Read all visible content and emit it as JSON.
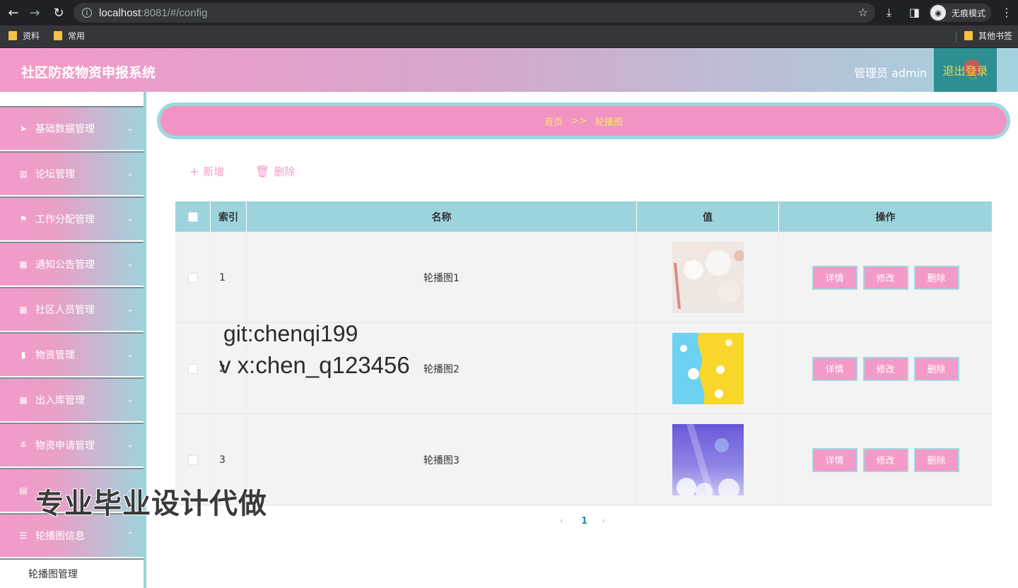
{
  "browser": {
    "url_host": "localhost",
    "url_rest": ":8081/#/config",
    "incognito_label": "无痕模式",
    "bookmarks": [
      "资料",
      "常用"
    ],
    "other_bookmarks": "其他书签"
  },
  "header": {
    "title": "社区防疫物资申报系统",
    "admin_label": "管理员 admin",
    "logout_label": "退出登录"
  },
  "sidebar": {
    "items": [
      {
        "label": "基础数据管理",
        "icon": "send-icon"
      },
      {
        "label": "论坛管理",
        "icon": "chart-icon"
      },
      {
        "label": "工作分配管理",
        "icon": "flag-icon"
      },
      {
        "label": "通知公告管理",
        "icon": "grid-icon"
      },
      {
        "label": "社区人员管理",
        "icon": "grid-icon"
      },
      {
        "label": "物资管理",
        "icon": "bar-chart-icon"
      },
      {
        "label": "出入库管理",
        "icon": "grid-icon"
      },
      {
        "label": "物资申请管理",
        "icon": "sliders-icon"
      },
      {
        "label": "",
        "icon": "clipboard-icon"
      },
      {
        "label": "轮播图信息",
        "icon": "list-icon"
      }
    ],
    "sub_item": "轮播图管理"
  },
  "breadcrumb": {
    "home": "首页",
    "separator": ">>",
    "current": "轮播图"
  },
  "actions": {
    "add": "新增",
    "delete": "删除"
  },
  "table": {
    "columns": [
      "索引",
      "名称",
      "值",
      "操作"
    ],
    "rows": [
      {
        "index": "1",
        "name": "轮播图1"
      },
      {
        "index": "2",
        "name": "轮播图2"
      },
      {
        "index": "3",
        "name": "轮播图3"
      }
    ],
    "op_detail": "详情",
    "op_edit": "修改",
    "op_delete": "删除"
  },
  "pagination": {
    "prev": "‹",
    "current": "1",
    "next": "›"
  },
  "watermarks": {
    "line1": "git:chenqi199",
    "line2": "v x:chen_q123456",
    "line3": "专业毕业设计代做"
  },
  "colors": {
    "pink": "#f49ac8",
    "teal": "#9cd4dd",
    "dark_teal": "#2d8f92"
  }
}
